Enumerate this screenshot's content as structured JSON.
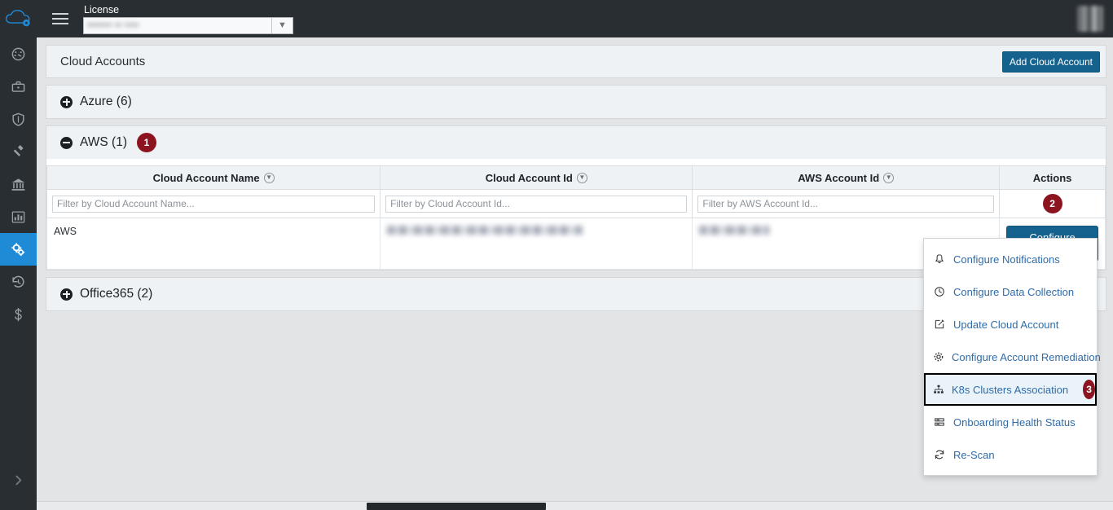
{
  "topbar": {
    "logo_icon": "cloud-gear-logo",
    "menu_icon": "hamburger-menu-icon",
    "license_label": "License",
    "license_value_redacted": "••••••• •• ••••",
    "license_chevron_icon": "chevron-down-icon",
    "avatar_icon": "user-avatar"
  },
  "sidebar": {
    "items": [
      {
        "name": "dashboard",
        "icon": "gauge-icon"
      },
      {
        "name": "assets",
        "icon": "briefcase-icon"
      },
      {
        "name": "security",
        "icon": "shield-icon"
      },
      {
        "name": "enforcement",
        "icon": "gavel-icon"
      },
      {
        "name": "compliance",
        "icon": "bank-icon"
      },
      {
        "name": "reports",
        "icon": "bar-chart-icon"
      },
      {
        "name": "settings",
        "icon": "gears-icon",
        "active": true
      },
      {
        "name": "history",
        "icon": "history-icon"
      },
      {
        "name": "cost",
        "icon": "dollar-icon"
      }
    ],
    "expand_icon": "chevron-right-icon"
  },
  "page": {
    "title": "Cloud Accounts",
    "add_button": "Add Cloud Account"
  },
  "accordions": [
    {
      "label": "Azure (6)",
      "expanded": false,
      "badge": null
    },
    {
      "label": "AWS (1)",
      "expanded": true,
      "badge": "1"
    },
    {
      "label": "Office365 (2)",
      "expanded": false,
      "badge": null
    }
  ],
  "table": {
    "columns": [
      {
        "header": "Cloud Account Name",
        "sortable": true,
        "filter_placeholder": "Filter by Cloud Account Name..."
      },
      {
        "header": "Cloud Account Id",
        "sortable": true,
        "filter_placeholder": "Filter by Cloud Account Id..."
      },
      {
        "header": "AWS Account Id",
        "sortable": true,
        "filter_placeholder": "Filter by AWS Account Id..."
      },
      {
        "header": "Actions",
        "sortable": false,
        "filter_placeholder": null
      }
    ],
    "rows": [
      {
        "cloud_account_name": "AWS",
        "cloud_account_id": "",
        "aws_account_id": "",
        "action_button": "Configure Account"
      }
    ],
    "actions_badge": "2"
  },
  "dropdown": {
    "open": true,
    "items": [
      {
        "label": "Configure Notifications",
        "icon": "bell-icon",
        "highlighted": false,
        "badge": null
      },
      {
        "label": "Configure Data Collection",
        "icon": "clock-icon",
        "highlighted": false,
        "badge": null
      },
      {
        "label": "Update Cloud Account",
        "icon": "edit-square-icon",
        "highlighted": false,
        "badge": null
      },
      {
        "label": "Configure Account Remediation",
        "icon": "gear-icon",
        "highlighted": false,
        "badge": null
      },
      {
        "label": "K8s Clusters Association",
        "icon": "sitemap-icon",
        "highlighted": true,
        "badge": "3"
      },
      {
        "label": "Onboarding Health Status",
        "icon": "server-list-icon",
        "highlighted": false,
        "badge": null
      },
      {
        "label": "Re-Scan",
        "icon": "refresh-icon",
        "highlighted": false,
        "badge": null
      }
    ]
  },
  "colors": {
    "topbar_bg": "#292e33",
    "accent_blue": "#15628f",
    "active_sidebar": "#1f8bd6",
    "badge_red": "#8c1420",
    "link_blue": "#2f6ca8",
    "panel_bg": "#eef2f5"
  }
}
